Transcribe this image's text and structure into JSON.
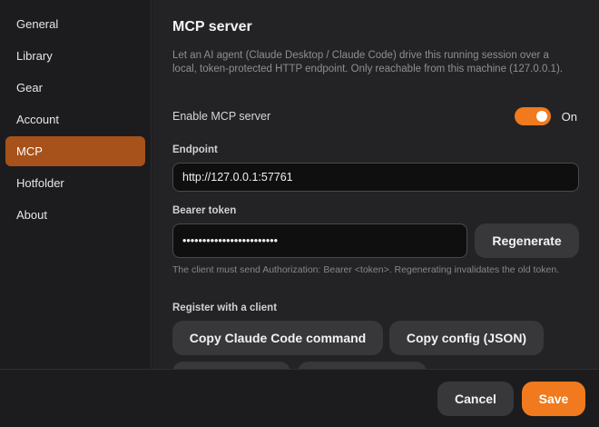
{
  "sidebar": {
    "items": [
      {
        "label": "General"
      },
      {
        "label": "Library"
      },
      {
        "label": "Gear"
      },
      {
        "label": "Account"
      },
      {
        "label": "MCP"
      },
      {
        "label": "Hotfolder"
      },
      {
        "label": "About"
      }
    ],
    "active": "MCP"
  },
  "main": {
    "title": "MCP server",
    "description": "Let an AI agent (Claude Desktop / Claude Code) drive this running session over a local, token-protected HTTP endpoint. Only reachable from this machine (127.0.0.1).",
    "enable": {
      "label": "Enable MCP server",
      "state_label": "On",
      "enabled": true
    },
    "endpoint": {
      "label": "Endpoint",
      "value": "http://127.0.0.1:57761"
    },
    "token": {
      "label": "Bearer token",
      "value": "••••••••••••••••••••••••",
      "regenerate_label": "Regenerate",
      "hint": "The client must send Authorization: Bearer <token>. Regenerating invalidates the old token."
    },
    "register": {
      "label": "Register with a client",
      "buttons": [
        {
          "label": "Copy Claude Code command"
        },
        {
          "label": "Copy config (JSON)"
        }
      ]
    }
  },
  "footer": {
    "cancel_label": "Cancel",
    "save_label": "Save"
  },
  "colors": {
    "accent": "#f07a1d",
    "active_nav": "#a6521a",
    "background": "#1c1c1e",
    "panel": "#232326"
  }
}
